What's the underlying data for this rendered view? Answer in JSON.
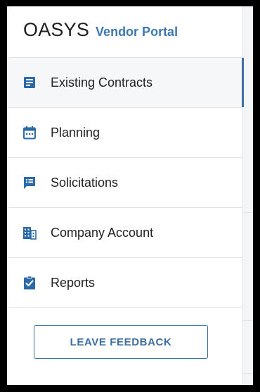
{
  "brand": {
    "title": "OASYS",
    "subtitle": "Vendor Portal"
  },
  "nav": {
    "items": [
      {
        "label": "Existing Contracts",
        "icon": "contracts-icon",
        "active": true
      },
      {
        "label": "Planning",
        "icon": "calendar-icon",
        "active": false
      },
      {
        "label": "Solicitations",
        "icon": "message-list-icon",
        "active": false
      },
      {
        "label": "Company Account",
        "icon": "building-icon",
        "active": false
      },
      {
        "label": "Reports",
        "icon": "clipboard-check-icon",
        "active": false
      }
    ]
  },
  "feedback_button": {
    "label": "LEAVE FEEDBACK"
  },
  "colors": {
    "accent": "#3c6ea0",
    "brand_blue": "#3c78b4",
    "icon_blue": "#2b6aa8"
  }
}
